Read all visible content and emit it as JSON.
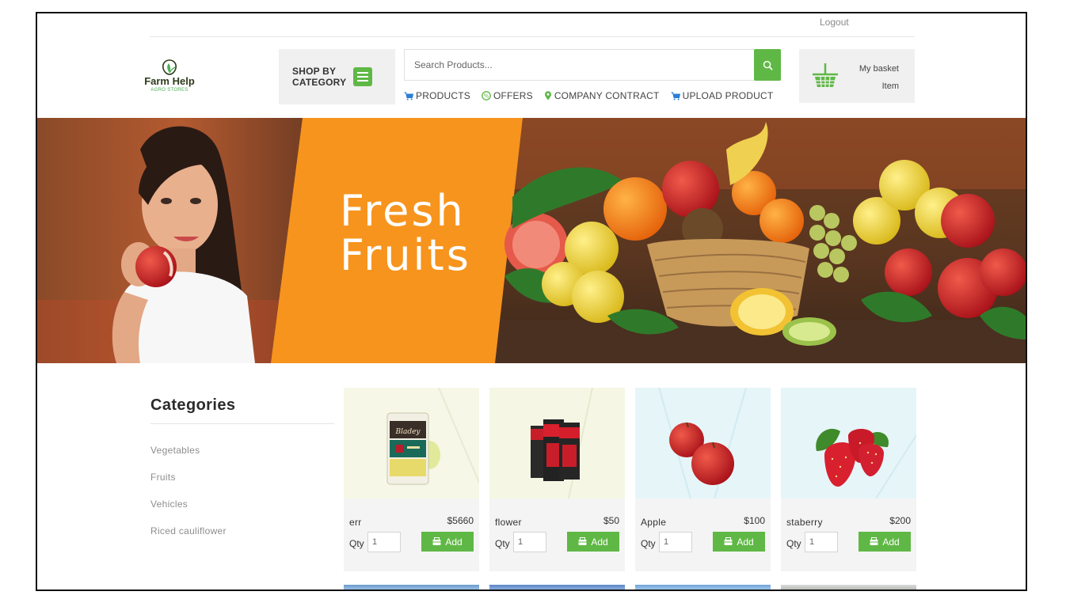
{
  "top": {
    "logout": "Logout"
  },
  "logo": {
    "name": "Farm Help",
    "sub": "AGRO STORES"
  },
  "shop_by_category": {
    "line1": "SHOP BY",
    "line2": "CATEGORY"
  },
  "search": {
    "placeholder": "Search Products..."
  },
  "nav": [
    {
      "label": "PRODUCTS",
      "icon": "cart-icon"
    },
    {
      "label": "OFFERS",
      "icon": "offer-badge-icon"
    },
    {
      "label": "COMPANY CONTRACT",
      "icon": "map-pin-icon"
    },
    {
      "label": "UPLOAD PRODUCT",
      "icon": "cart-icon"
    }
  ],
  "basket": {
    "title": "My basket",
    "subtitle": "Item"
  },
  "hero": {
    "line1": "Fresh",
    "line2": "Fruits"
  },
  "categories": {
    "title": "Categories",
    "items": [
      "Vegetables",
      "Fruits",
      "Vehicles",
      "Riced cauliflower"
    ]
  },
  "products": [
    {
      "name": "err",
      "price": "$5660",
      "qty_label": "Qty",
      "qty": "1",
      "add_label": "Add"
    },
    {
      "name": "flower",
      "price": "$50",
      "qty_label": "Qty",
      "qty": "1",
      "add_label": "Add"
    },
    {
      "name": "Apple",
      "price": "$100",
      "qty_label": "Qty",
      "qty": "1",
      "add_label": "Add"
    },
    {
      "name": "staberry",
      "price": "$200",
      "qty_label": "Qty",
      "qty": "1",
      "add_label": "Add"
    }
  ],
  "colors": {
    "accent_green": "#5fb845",
    "hero_orange": "#f7941d",
    "panel_gray": "#f0f0f0"
  }
}
